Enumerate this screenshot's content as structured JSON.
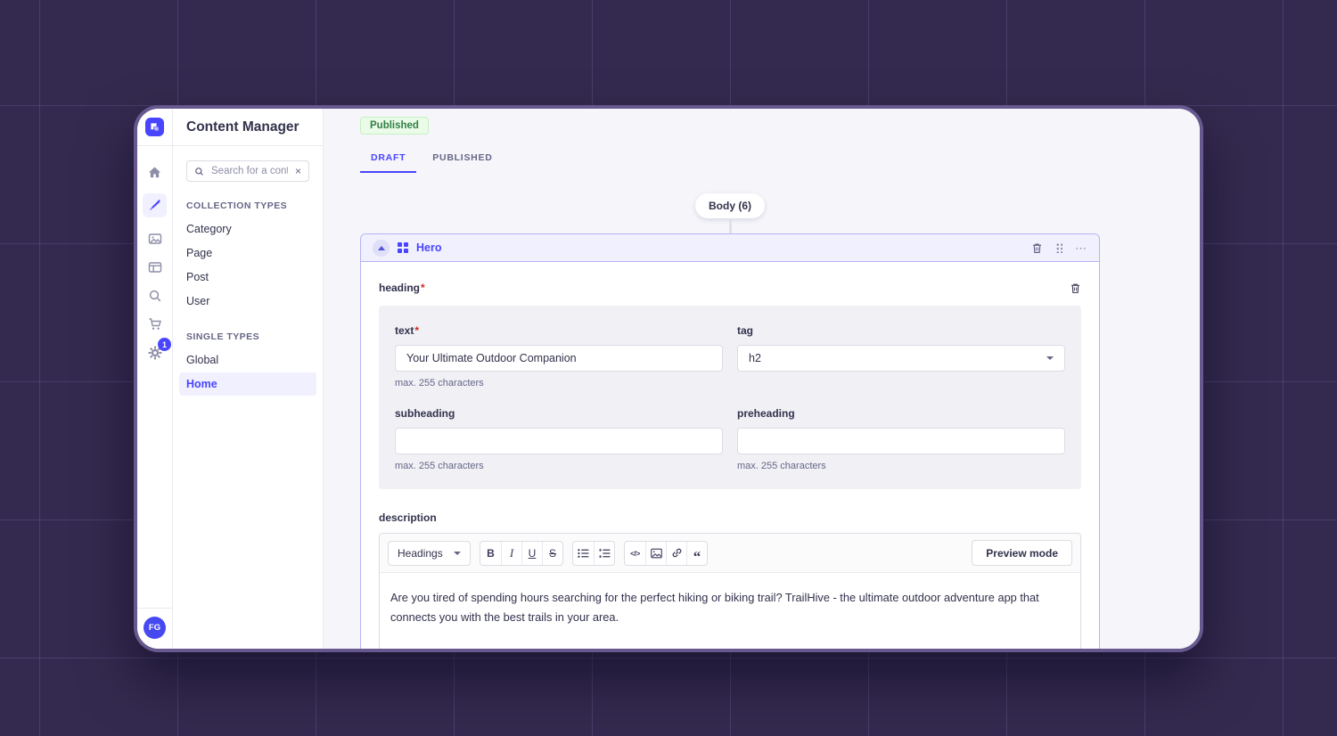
{
  "colors": {
    "accent": "#4945ff",
    "accent_bg": "#f0f0ff",
    "success_text": "#328048",
    "success_bg": "#eafbe7",
    "text": "#32324d",
    "muted": "#666687",
    "window_border": "#675990",
    "page_bg": "#342a4f"
  },
  "rail": {
    "settings_badge": "1",
    "avatar_initials": "FG",
    "icons": [
      "strapi-logo",
      "home",
      "content-manager-pen",
      "media-library",
      "content-type-builder",
      "search",
      "marketplace-cart",
      "settings-gear"
    ]
  },
  "sidebar": {
    "title": "Content Manager",
    "search": {
      "placeholder": "Search for a cont",
      "clear_icon": "×"
    },
    "sections": [
      {
        "label": "COLLECTION TYPES",
        "items": [
          {
            "label": "Category"
          },
          {
            "label": "Page"
          },
          {
            "label": "Post"
          },
          {
            "label": "User"
          }
        ]
      },
      {
        "label": "SINGLE TYPES",
        "items": [
          {
            "label": "Global"
          },
          {
            "label": "Home",
            "active": true
          }
        ]
      }
    ]
  },
  "content": {
    "status_badge": "Published",
    "tabs": [
      {
        "label": "DRAFT",
        "active": true
      },
      {
        "label": "PUBLISHED",
        "active": false
      }
    ],
    "body_chip": "Body (6)",
    "required_marker": "*",
    "hero": {
      "title": "Hero",
      "heading": {
        "label": "heading"
      },
      "fields": {
        "text": {
          "label": "text",
          "value": "Your Ultimate Outdoor Companion",
          "hint": "max. 255 characters"
        },
        "tag": {
          "label": "tag",
          "value": "h2"
        },
        "subheading": {
          "label": "subheading",
          "value": "",
          "hint": "max. 255 characters"
        },
        "preheading": {
          "label": "preheading",
          "value": "",
          "hint": "max. 255 characters"
        },
        "description": {
          "label": "description"
        }
      },
      "editor": {
        "headings_label": "Headings",
        "buttons": {
          "bold": "B",
          "italic": "I",
          "underline": "U",
          "strikethrough": "S",
          "code": "</>",
          "quote": "“"
        },
        "preview_label": "Preview mode",
        "content": "Are you tired of spending hours searching for the perfect hiking or biking trail? TrailHive - the ultimate outdoor adventure app that connects you with the best trails in your area."
      },
      "ellipsis_glyph": "⋯"
    }
  }
}
